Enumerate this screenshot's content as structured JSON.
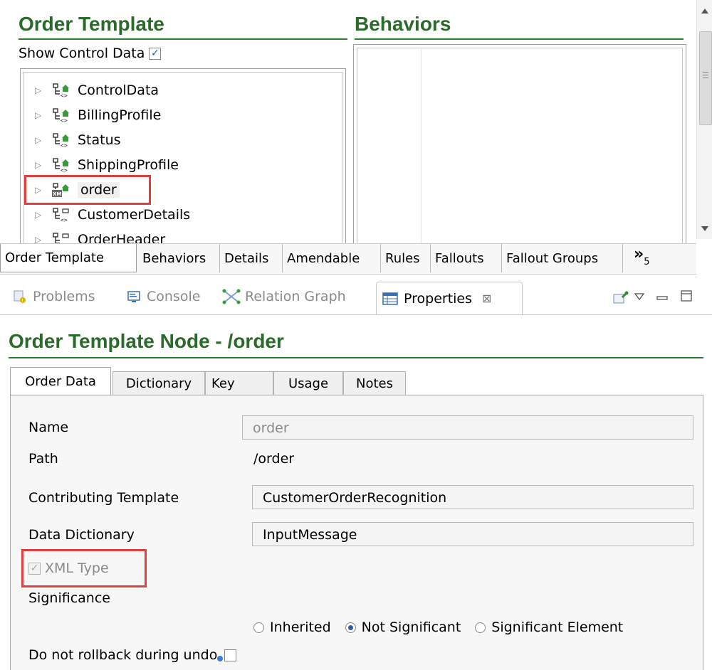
{
  "order_template_panel": {
    "title": "Order Template",
    "show_control_data_label": "Show Control Data",
    "show_control_data_checked": true,
    "tree": [
      {
        "label": "ControlData",
        "icon": "tree-structure-icon"
      },
      {
        "label": "BillingProfile",
        "icon": "tree-structure-icon"
      },
      {
        "label": "Status",
        "icon": "tree-structure-icon"
      },
      {
        "label": "ShippingProfile",
        "icon": "tree-structure-icon"
      },
      {
        "label": "order",
        "icon": "xml-node-icon",
        "selected": true
      },
      {
        "label": "CustomerDetails",
        "icon": "tree-structure-icon"
      },
      {
        "label": "OrderHeader",
        "icon": "tree-structure-icon"
      }
    ]
  },
  "behaviors_panel": {
    "title": "Behaviors"
  },
  "editor_tabs": {
    "items": [
      "Order Template",
      "Behaviors",
      "Details",
      "Amendable",
      "Rules",
      "Fallouts",
      "Fallout Groups"
    ],
    "overflow_label": "»",
    "overflow_count": "5"
  },
  "view_tabs": {
    "items": [
      {
        "label": "Problems",
        "icon": "problems-icon"
      },
      {
        "label": "Console",
        "icon": "console-icon"
      },
      {
        "label": "Relation Graph",
        "icon": "relation-graph-icon"
      },
      {
        "label": "Properties",
        "icon": "properties-icon",
        "active": true
      }
    ],
    "close_glyph": "⊠"
  },
  "properties": {
    "title": "Order Template Node - /order",
    "tabs": [
      "Order Data",
      "Dictionary",
      "Key",
      "Usage",
      "Notes"
    ],
    "active_tab": "Order Data",
    "fields": {
      "name_label": "Name",
      "name_value": "order",
      "path_label": "Path",
      "path_value": "/order",
      "contributing_label": "Contributing Template",
      "contributing_value": "CustomerOrderRecognition",
      "dictionary_label": "Data Dictionary",
      "dictionary_value": "InputMessage",
      "xml_type_label": "XML Type",
      "xml_type_checked": true,
      "significance_label": "Significance",
      "radio_options": [
        "Inherited",
        "Not Significant",
        "Significant Element"
      ],
      "radio_selected": "Not Significant",
      "rollback_label": "Do not rollback during undo",
      "rollback_checked": false
    }
  },
  "colors": {
    "section_title": "#2a6a2a",
    "highlight_box": "#e0413f"
  }
}
